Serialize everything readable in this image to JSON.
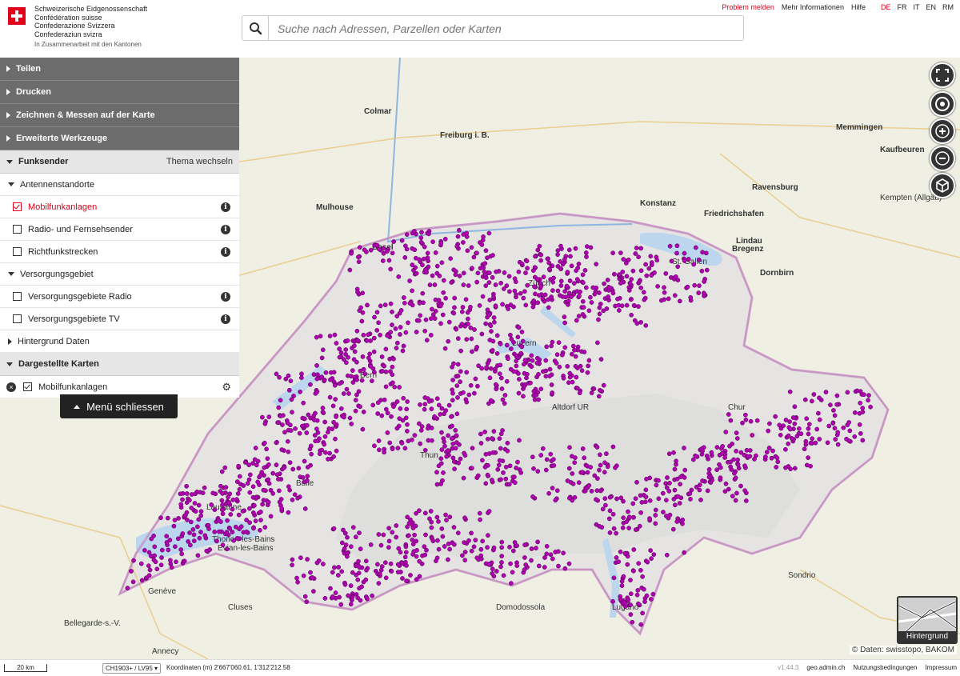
{
  "header": {
    "confederation": [
      "Schweizerische Eidgenossenschaft",
      "Confédération suisse",
      "Confederazione Svizzera",
      "Confederaziun svizra"
    ],
    "cantons_note": "In Zusammenarbeit mit den Kantonen",
    "links": {
      "report": "Problem melden",
      "more_info": "Mehr Informationen",
      "help": "Hilfe"
    },
    "languages": [
      "DE",
      "FR",
      "IT",
      "EN",
      "RM"
    ],
    "active_language": "DE"
  },
  "search": {
    "placeholder": "Suche nach Adressen, Parzellen oder Karten"
  },
  "menu": {
    "sections": [
      "Teilen",
      "Drucken",
      "Zeichnen & Messen auf der Karte",
      "Erweiterte Werkzeuge"
    ],
    "theme": {
      "title": "Funksender",
      "switch_label": "Thema wechseln"
    },
    "groups": [
      {
        "label": "Antennenstandorte",
        "layers": [
          {
            "label": "Mobilfunkanlagen",
            "checked": true
          },
          {
            "label": "Radio- und Fernsehsender",
            "checked": false
          },
          {
            "label": "Richtfunkstrecken",
            "checked": false
          }
        ]
      },
      {
        "label": "Versorgungsgebiet",
        "layers": [
          {
            "label": "Versorgungsgebiete Radio",
            "checked": false
          },
          {
            "label": "Versorgungsgebiete TV",
            "checked": false
          }
        ]
      }
    ],
    "background_group": "Hintergrund Daten",
    "displayed_maps": {
      "title": "Dargestellte Karten",
      "layers": [
        {
          "label": "Mobilfunkanlagen",
          "checked": true
        }
      ]
    },
    "close_label": "Menü schliessen"
  },
  "map": {
    "point_color": "#b400b4",
    "place_labels": [
      "Colmar",
      "Freiburg i. B.",
      "Mulhouse",
      "Basel",
      "Konstanz",
      "Friedrichshafen",
      "Lindau",
      "Bregenz",
      "Dornbirn",
      "Memmingen",
      "Kaufbeuren",
      "Ravensburg",
      "Kempten (Allgäu)",
      "St. Gallen",
      "Chur",
      "Lausanne",
      "Genève",
      "Annecy",
      "Thonon-les-Bains",
      "Evian-les-Bains",
      "Domodossola",
      "Sondrio",
      "Lugano",
      "Altdorf UR",
      "Bulle",
      "Bellegarde-s.-V.",
      "Cluses",
      "Zürich",
      "Bern",
      "Luzern",
      "Thun"
    ],
    "controls": [
      "fullscreen",
      "geolocation",
      "zoom-in",
      "zoom-out",
      "3d"
    ],
    "background_label": "Hintergrund",
    "copyright": "© Daten: swisstopo, BAKOM"
  },
  "footer": {
    "scale": "20 km",
    "projection": "CH1903+ / LV95",
    "coordinates": "Koordinaten (m) 2'667'060.61, 1'312'212.58",
    "version": "v1.44.3",
    "links": [
      "geo.admin.ch",
      "Nutzungsbedingungen",
      "Impressum"
    ]
  }
}
